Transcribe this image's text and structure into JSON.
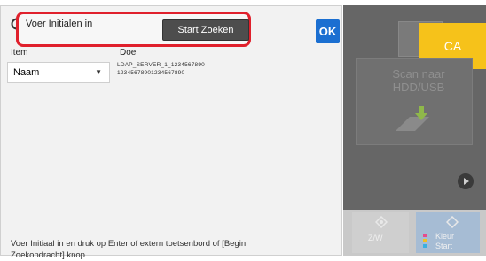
{
  "search": {
    "input_text": "Voer Initialen in",
    "start_label": "Start Zoeken"
  },
  "ok_label": "OK",
  "columns": {
    "item": "Item",
    "dest": "Doel"
  },
  "item_select": {
    "value": "Naam"
  },
  "destination": {
    "line1": "LDAP_SERVER_1_1234567890",
    "line2": "12345678901234567890"
  },
  "info": "Voer Initiaal in en druk op Enter of extern toetsenbord of [Begin Zoekopdracht] knop.",
  "right": {
    "ca_label": "CA",
    "scan_label": "Scan naar HDD/USB",
    "zw_label": "Z/W",
    "kleur_label": "Kleur",
    "start_label": "Start"
  },
  "colors": {
    "highlight": "#e0202c",
    "ok_blue": "#1b6fd1",
    "ca_yellow": "#f6c21a",
    "dark_panel": "#666666"
  },
  "icons": [
    "search-icon",
    "chevron-down-icon",
    "scan-to-storage-icon",
    "play-icon",
    "start-diamond-icon"
  ]
}
